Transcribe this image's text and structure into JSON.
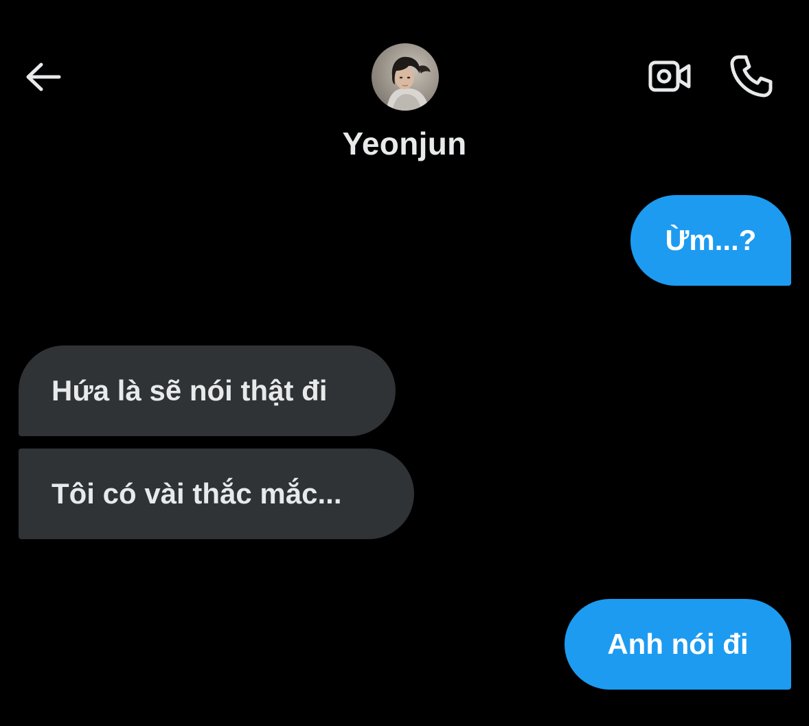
{
  "header": {
    "back_icon": "arrow-left-icon",
    "contact_name": "Yeonjun",
    "avatar_description": "profile-photo",
    "video_call_icon": "video-camera-icon",
    "phone_call_icon": "phone-icon",
    "icon_color": "#e7e9ea"
  },
  "messages": [
    {
      "direction": "sent",
      "text": "Ừm...?"
    },
    {
      "direction": "received",
      "text": "Hứa là sẽ nói thật đi"
    },
    {
      "direction": "received",
      "text": "Tôi có vài thắc mắc..."
    },
    {
      "direction": "sent",
      "text": "Anh nói đi"
    }
  ],
  "colors": {
    "background": "#000000",
    "sent_bubble": "#1d9bf0",
    "received_bubble": "#2f3336",
    "text": "#e7e9ea"
  }
}
